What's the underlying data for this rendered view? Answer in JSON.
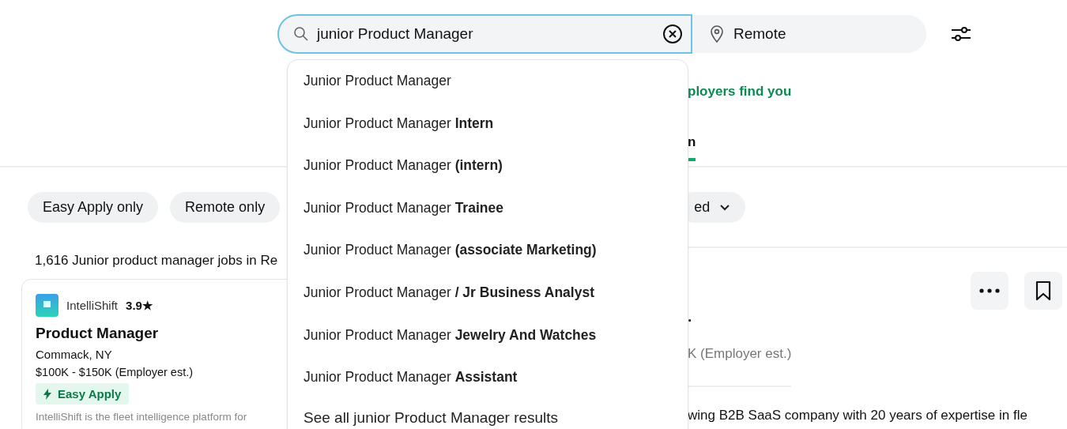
{
  "search": {
    "query": "junior Product Manager",
    "location": "Remote"
  },
  "suggestions": [
    {
      "text": "Junior Product Manager"
    },
    {
      "text": "Junior Product Manager **Intern**"
    },
    {
      "text": "Junior Product Manager **(intern)**"
    },
    {
      "text": "Junior Product Manager **Trainee**"
    },
    {
      "text": "Junior Product Manager **(associate Marketing)**"
    },
    {
      "text": "Junior Product Manager **/ Jr Business Analyst**"
    },
    {
      "text": "Junior Product Manager **Jewelry And Watches**"
    },
    {
      "text": "Junior Product Manager **Assistant**"
    }
  ],
  "see_all": "See all junior Product Manager results",
  "banner_fragment": "ployers find you",
  "tab_fragment": {
    "label": "n",
    "selected": true
  },
  "filters": [
    {
      "label": "Easy Apply only",
      "kind": "toggle"
    },
    {
      "label": "Remote only",
      "kind": "toggle"
    },
    {
      "label": "ed",
      "kind": "dropdown"
    }
  ],
  "results_count": "1,616 Junior product manager jobs in Re",
  "job_card": {
    "company": "IntelliShift",
    "rating": "3.9★",
    "title": "Product Manager",
    "location": "Commack, NY",
    "salary": "$100K - $150K (Employer est.)",
    "badge": "Easy Apply",
    "snippet": "IntelliShift is the fleet intelligence platform for"
  },
  "detail": {
    "title_fragment": ".",
    "salary_fragment": "K (Employer est.)",
    "description_fragment": "wing B2B SaaS company with 20 years of expertise in fle"
  }
}
